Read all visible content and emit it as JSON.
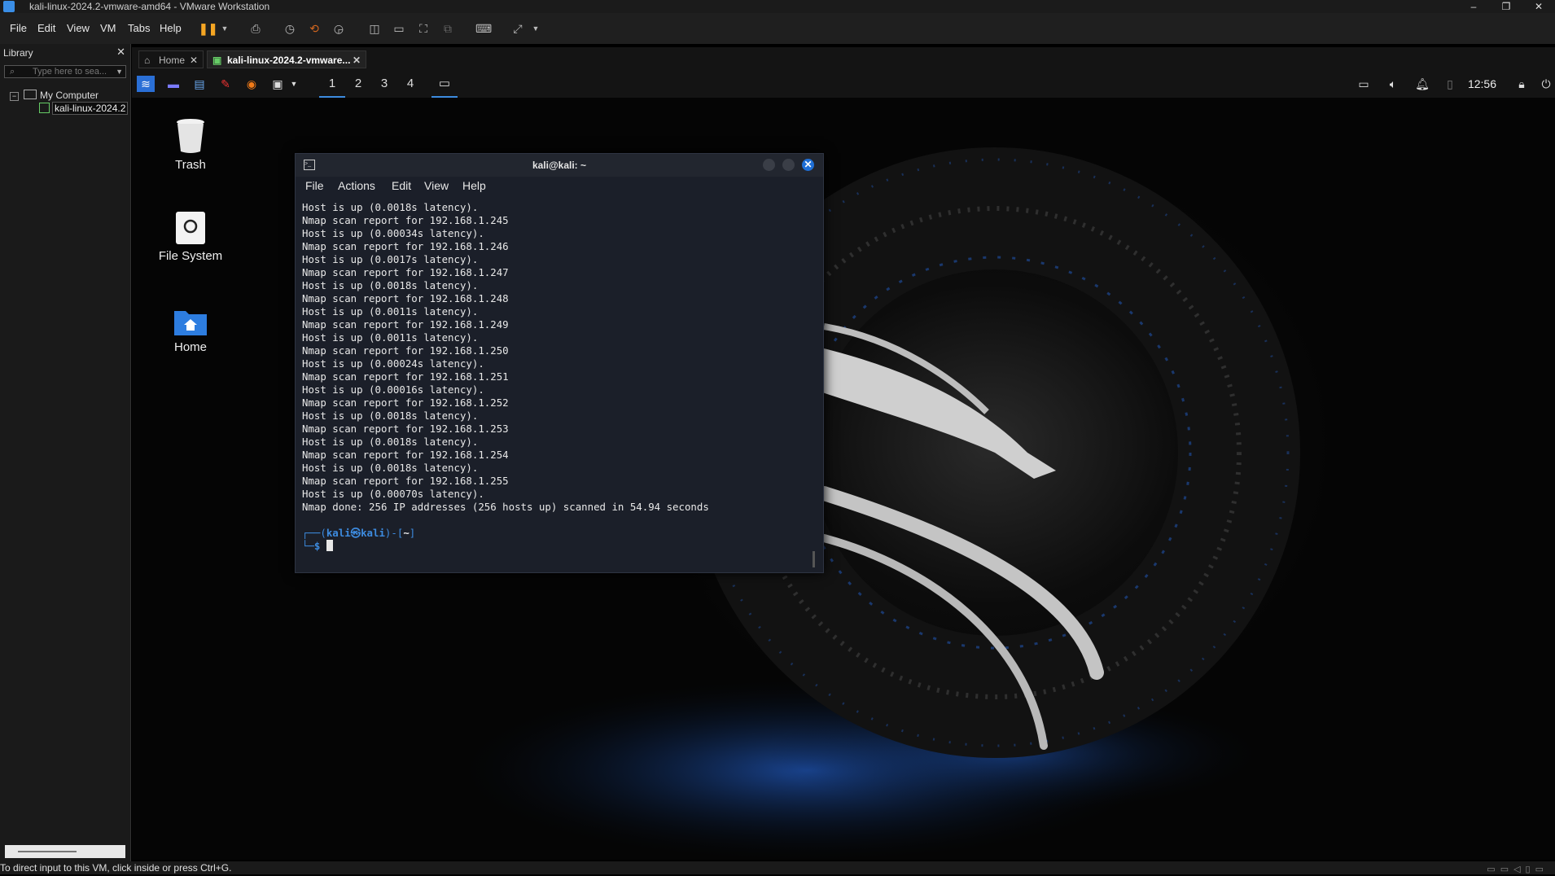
{
  "window": {
    "title": "kali-linux-2024.2-vmware-amd64 - VMware Workstation",
    "controls": {
      "minimize": "–",
      "restore": "❐",
      "close": "✕"
    }
  },
  "menubar": {
    "items": [
      "File",
      "Edit",
      "View",
      "VM",
      "Tabs",
      "Help"
    ]
  },
  "library": {
    "title": "Library",
    "close": "✕",
    "search_placeholder": "Type here to sea...",
    "root": "My Computer",
    "vm_item": "kali-linux-2024.2"
  },
  "tabs": [
    {
      "label": "Home",
      "close": "✕"
    },
    {
      "label": "kali-linux-2024.2-vmware...",
      "close": "✕"
    }
  ],
  "statusbar": {
    "text": "To direct input to this VM, click inside or press Ctrl+G."
  },
  "guest": {
    "panel": {
      "workspaces": [
        "1",
        "2",
        "3",
        "4"
      ],
      "active_workspace": "1",
      "clock": "12:56"
    },
    "desktop_icons": [
      {
        "label": "Trash",
        "icon": "trash-icon"
      },
      {
        "label": "File System",
        "icon": "drive-icon"
      },
      {
        "label": "Home",
        "icon": "home-folder-icon"
      }
    ],
    "terminal": {
      "title": "kali@kali: ~",
      "menu": [
        "File",
        "Actions",
        "Edit",
        "View",
        "Help"
      ],
      "lines": [
        "Host is up (0.0018s latency).",
        "Nmap scan report for 192.168.1.245",
        "Host is up (0.00034s latency).",
        "Nmap scan report for 192.168.1.246",
        "Host is up (0.0017s latency).",
        "Nmap scan report for 192.168.1.247",
        "Host is up (0.0018s latency).",
        "Nmap scan report for 192.168.1.248",
        "Host is up (0.0011s latency).",
        "Nmap scan report for 192.168.1.249",
        "Host is up (0.0011s latency).",
        "Nmap scan report for 192.168.1.250",
        "Host is up (0.00024s latency).",
        "Nmap scan report for 192.168.1.251",
        "Host is up (0.00016s latency).",
        "Nmap scan report for 192.168.1.252",
        "Host is up (0.0018s latency).",
        "Nmap scan report for 192.168.1.253",
        "Host is up (0.0018s latency).",
        "Nmap scan report for 192.168.1.254",
        "Host is up (0.0018s latency).",
        "Nmap scan report for 192.168.1.255",
        "Host is up (0.00070s latency).",
        "Nmap done: 256 IP addresses (256 hosts up) scanned in 54.94 seconds"
      ],
      "prompt": {
        "open": "┌──(",
        "user": "kali㉿kali",
        "mid": ")-[",
        "dir": "~",
        "close": "]",
        "second": "└─$ "
      }
    }
  },
  "colors": {
    "accent": "#3d8bdf",
    "terminal_bg": "#1b1f29",
    "chrome_bg": "#1f1f1f"
  }
}
